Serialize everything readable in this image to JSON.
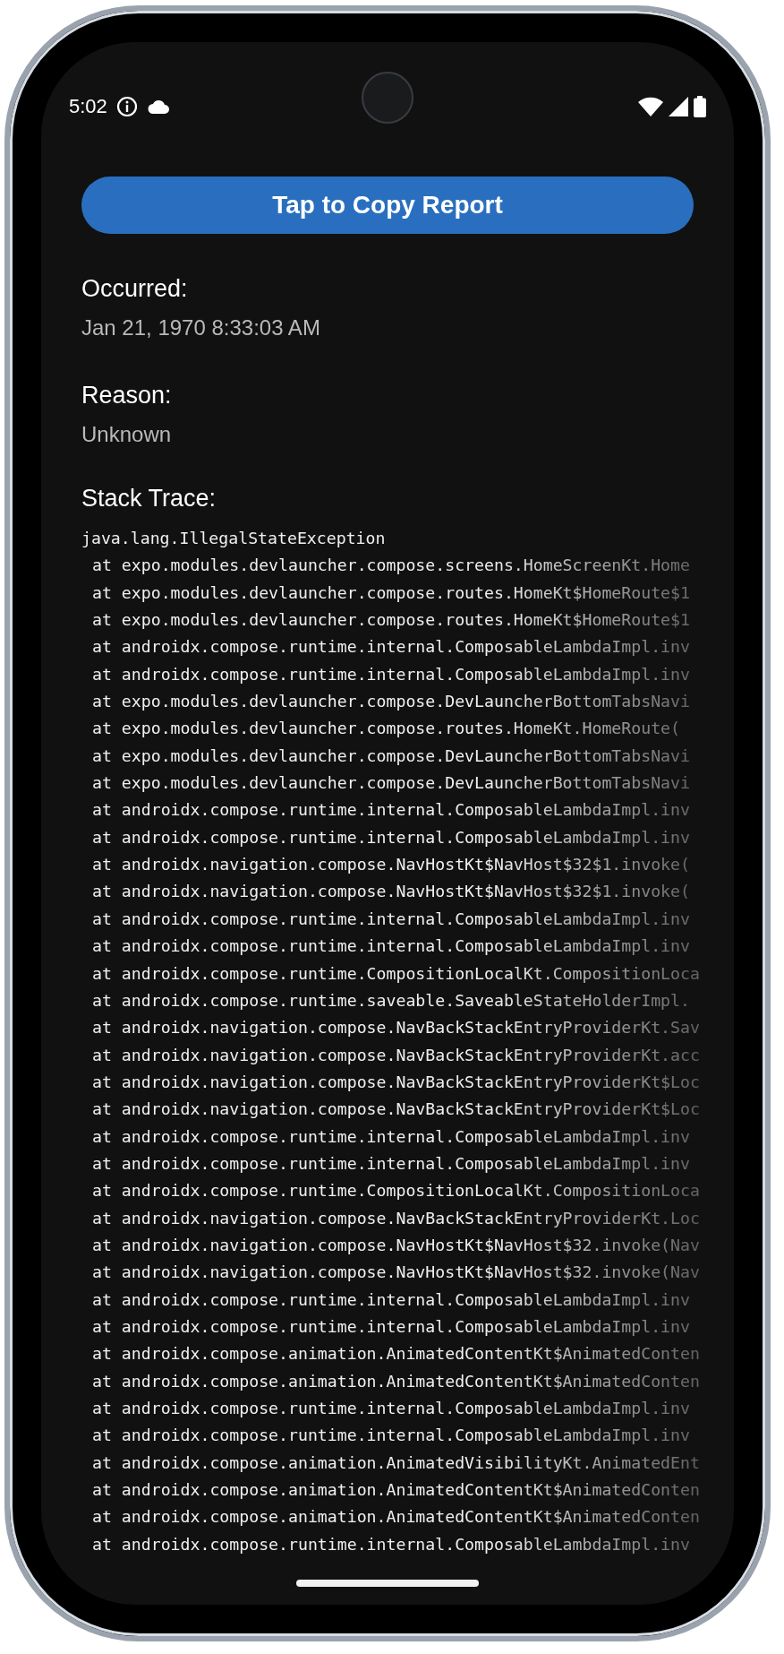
{
  "status_bar": {
    "time": "5:02"
  },
  "copy_button": {
    "label": "Tap to Copy Report"
  },
  "sections": [
    {
      "label": "Occurred:",
      "value": "Jan 21, 1970 8:33:03 AM"
    },
    {
      "label": "Reason:",
      "value": "Unknown"
    }
  ],
  "stack_trace": {
    "label": "Stack Trace:",
    "exception": "java.lang.IllegalStateException",
    "frames": [
      "at expo.modules.devlauncher.compose.screens.HomeScreenKt.Home",
      "at expo.modules.devlauncher.compose.routes.HomeKt$HomeRoute$1",
      "at expo.modules.devlauncher.compose.routes.HomeKt$HomeRoute$1",
      "at androidx.compose.runtime.internal.ComposableLambdaImpl.inv",
      "at androidx.compose.runtime.internal.ComposableLambdaImpl.inv",
      "at expo.modules.devlauncher.compose.DevLauncherBottomTabsNavi",
      "at expo.modules.devlauncher.compose.routes.HomeKt.HomeRoute(",
      "at expo.modules.devlauncher.compose.DevLauncherBottomTabsNavi",
      "at expo.modules.devlauncher.compose.DevLauncherBottomTabsNavi",
      "at androidx.compose.runtime.internal.ComposableLambdaImpl.inv",
      "at androidx.compose.runtime.internal.ComposableLambdaImpl.inv",
      "at androidx.navigation.compose.NavHostKt$NavHost$32$1.invoke(",
      "at androidx.navigation.compose.NavHostKt$NavHost$32$1.invoke(",
      "at androidx.compose.runtime.internal.ComposableLambdaImpl.inv",
      "at androidx.compose.runtime.internal.ComposableLambdaImpl.inv",
      "at androidx.compose.runtime.CompositionLocalKt.CompositionLoca",
      "at androidx.compose.runtime.saveable.SaveableStateHolderImpl.",
      "at androidx.navigation.compose.NavBackStackEntryProviderKt.Sav",
      "at androidx.navigation.compose.NavBackStackEntryProviderKt.acc",
      "at androidx.navigation.compose.NavBackStackEntryProviderKt$Loc",
      "at androidx.navigation.compose.NavBackStackEntryProviderKt$Loc",
      "at androidx.compose.runtime.internal.ComposableLambdaImpl.inv",
      "at androidx.compose.runtime.internal.ComposableLambdaImpl.inv",
      "at androidx.compose.runtime.CompositionLocalKt.CompositionLoca",
      "at androidx.navigation.compose.NavBackStackEntryProviderKt.Loc",
      "at androidx.navigation.compose.NavHostKt$NavHost$32.invoke(Nav",
      "at androidx.navigation.compose.NavHostKt$NavHost$32.invoke(Nav",
      "at androidx.compose.runtime.internal.ComposableLambdaImpl.inv",
      "at androidx.compose.runtime.internal.ComposableLambdaImpl.inv",
      "at androidx.compose.animation.AnimatedContentKt$AnimatedConten",
      "at androidx.compose.animation.AnimatedContentKt$AnimatedConten",
      "at androidx.compose.runtime.internal.ComposableLambdaImpl.inv",
      "at androidx.compose.runtime.internal.ComposableLambdaImpl.inv",
      "at androidx.compose.animation.AnimatedVisibilityKt.AnimatedEnt",
      "at androidx.compose.animation.AnimatedContentKt$AnimatedConten",
      "at androidx.compose.animation.AnimatedContentKt$AnimatedConten",
      "at androidx.compose.runtime.internal.ComposableLambdaImpl.inv"
    ]
  }
}
